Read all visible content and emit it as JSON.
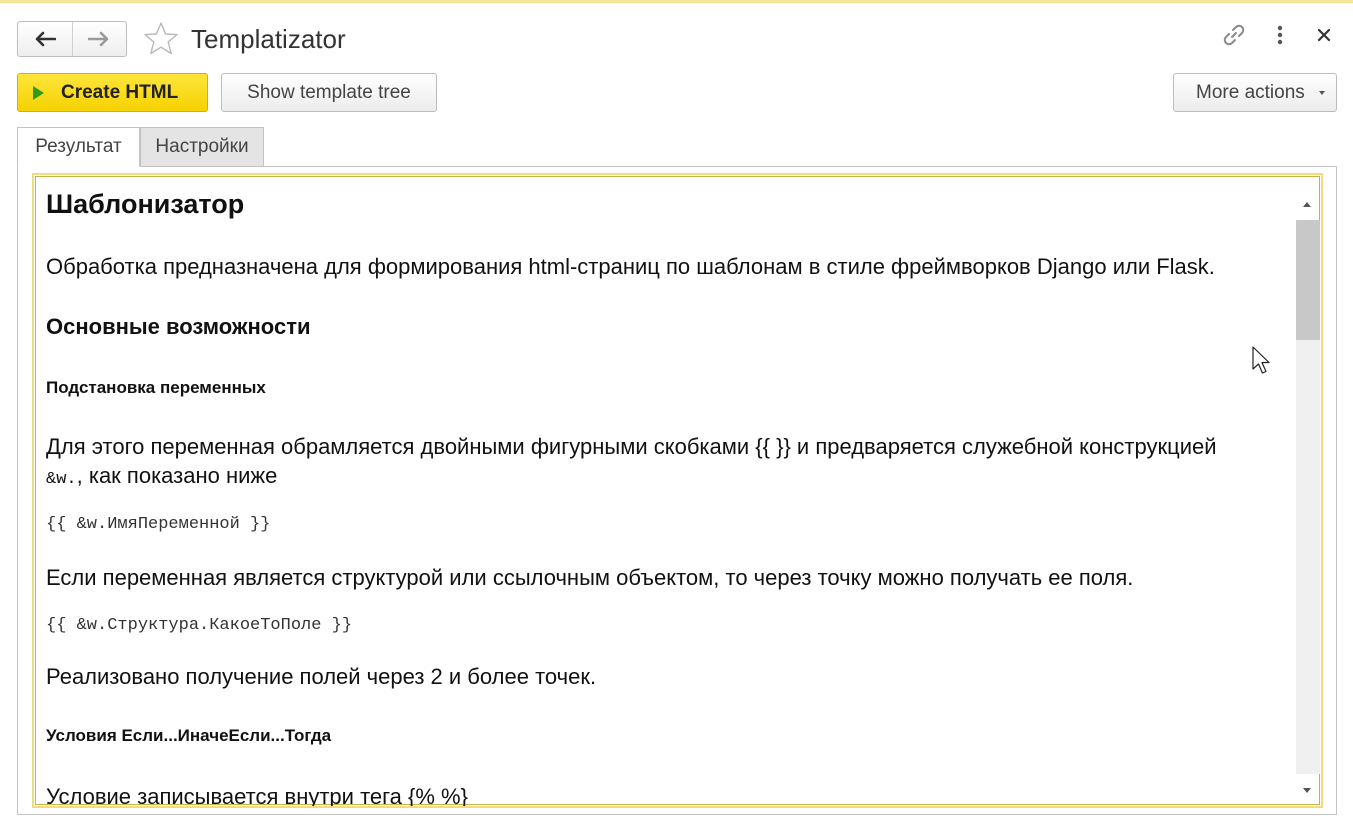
{
  "window": {
    "title": "Templatizator",
    "icons": [
      "back-arrow-icon",
      "forward-arrow-icon",
      "favorite-star-icon",
      "link-icon",
      "more-vertical-icon",
      "close-icon"
    ]
  },
  "toolbar": {
    "create_html_label": "Create HTML",
    "show_template_tree_label": "Show template tree",
    "more_actions_label": "More actions"
  },
  "tabs": [
    {
      "label": "Результат",
      "active": true
    },
    {
      "label": "Настройки",
      "active": false
    }
  ],
  "document": {
    "title": "Шаблонизатор",
    "intro": "Обработка предназначена для формирования html-страниц по шаблонам в стиле фреймворков Django или Flask.",
    "section_features": "Основные возможности",
    "subsection_vars": "Подстановка переменных",
    "vars_text_line1": "Для этого переменная обрамляется двойными фигурными скобками {{ }} и предваряется служебной конструкцией",
    "vars_code_inline": "&w.",
    "vars_text_line2_suffix": ", как показано ниже",
    "code_example1": "{{ &w.ИмяПеременной }}",
    "struct_text": "Если переменная является структурой или ссылочным объектом, то через точку можно получать ее поля.",
    "code_example2": "{{ &w.Структура.КакоеТоПоле }}",
    "dots_text": "Реализовано получение полей через 2 и более точек.",
    "subsection_conditions": "Условия Если...ИначеЕсли...Тогда",
    "conditions_text": "Условие записывается внутри тега {% %}"
  },
  "colors": {
    "primary_button": "#f5d200",
    "play_icon": "#2f9a1b",
    "viewer_border": "#f0dc7c",
    "inactive_tab": "#e4e4e4"
  },
  "scroll": {
    "position_fraction": 0.0
  }
}
